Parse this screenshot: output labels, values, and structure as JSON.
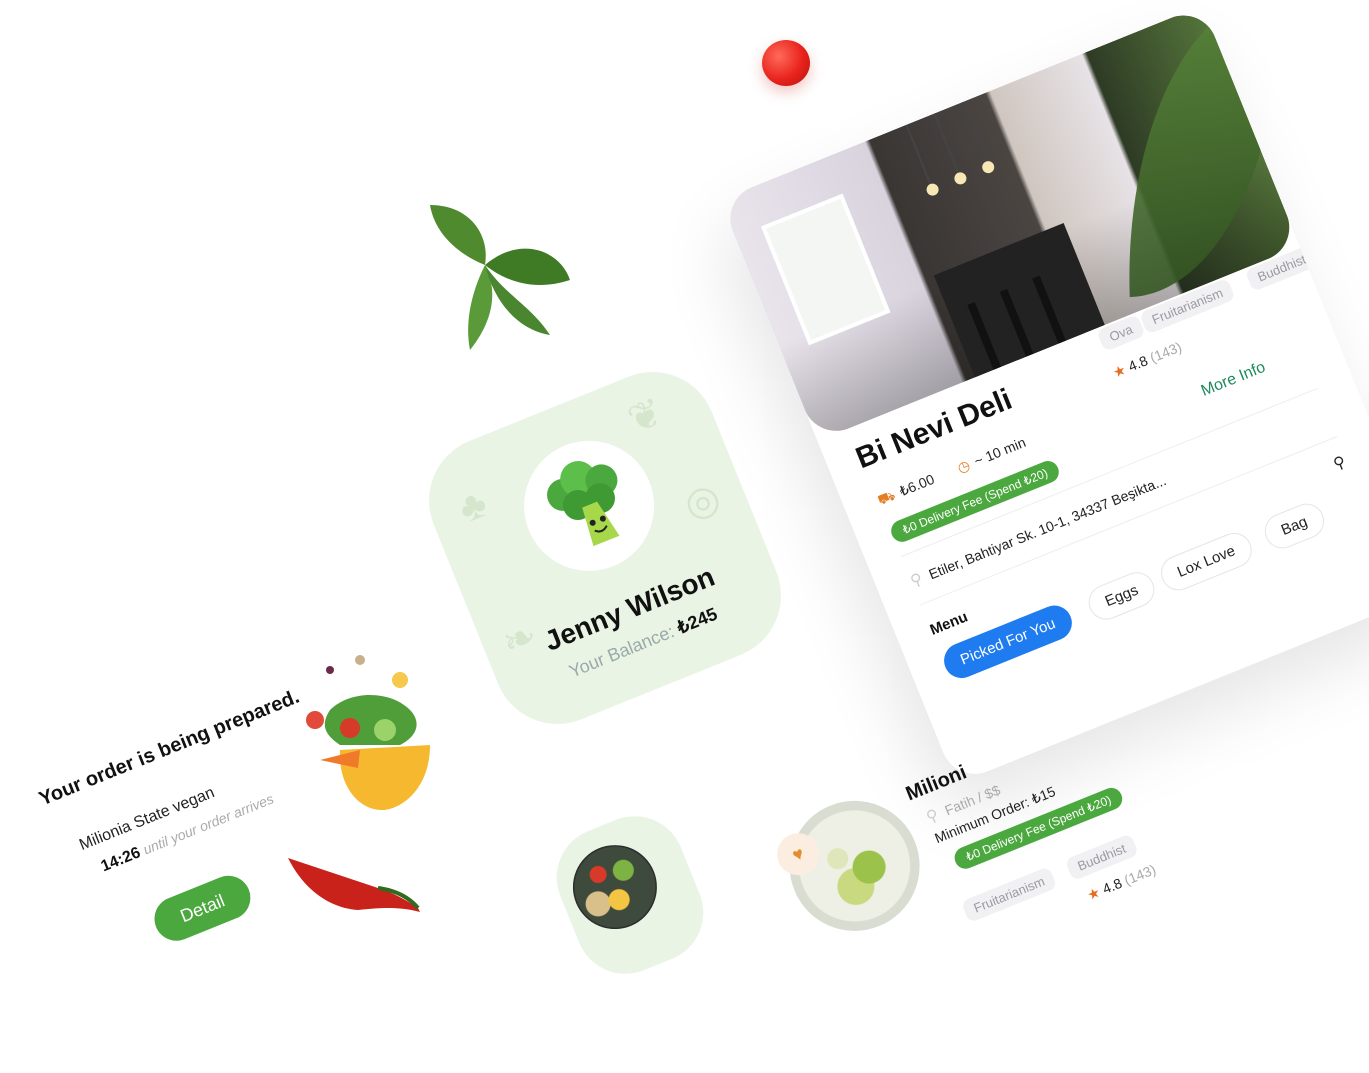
{
  "restaurant": {
    "name": "Bi Nevi Deli",
    "tags": [
      "Ova",
      "Fruitarianism",
      "Buddhist"
    ],
    "rating": "4.8",
    "rating_count": "(143)",
    "price": "₺6.00",
    "time": "~ 10 min",
    "delivery_fee": "₺0 Delivery Fee (Spend ₺20)",
    "more_info": "More Info",
    "address": "Etiler, Bahtiyar Sk. 10-1, 34337 Beşikta...",
    "menu_label": "Menu",
    "menu_chips": [
      "Picked For You",
      "Eggs",
      "Lox Love",
      "Bag"
    ]
  },
  "profile": {
    "name": "Jenny Wilson",
    "balance_label": "Your Balance:",
    "balance_value": "₺245"
  },
  "order": {
    "title": "Your order is being prepared.",
    "restaurant": "Milionia State vegan",
    "time": "14:26",
    "time_suffix": "until your order arrives",
    "detail_button": "Detail"
  },
  "list_item": {
    "name": "Milioni",
    "location": "Fatih",
    "price_level": "$$",
    "minimum_order": "Minimum Order: ₺15",
    "delivery_fee": "₺0 Delivery Fee (Spend ₺20)",
    "tags": [
      "Fruitarianism",
      "Buddhist"
    ],
    "rating": "4.8",
    "rating_count": "(143)"
  },
  "colors": {
    "accent_blue": "#1e7bf0",
    "green": "#4ba83e",
    "more_info": "#1f8a5e",
    "orange": "#e86b1f",
    "card_green": "#eaf4e5"
  },
  "icons": [
    "tomato-icon",
    "basil-icon",
    "chili-icon",
    "star-icon",
    "delivery-icon",
    "timer-icon",
    "pin-icon",
    "search-icon",
    "heart-icon",
    "broccoli-icon"
  ]
}
